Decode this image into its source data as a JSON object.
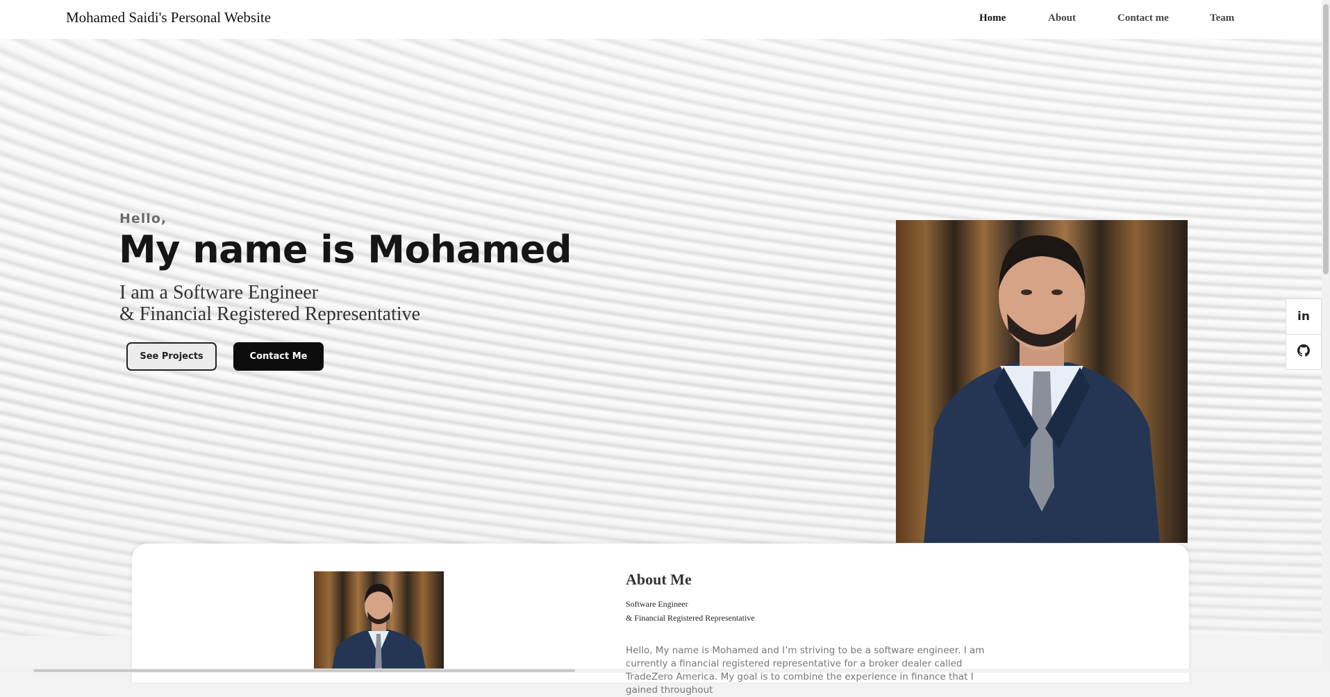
{
  "header": {
    "site_title": "Mohamed Saidi's Personal Website",
    "nav": [
      "Home",
      "About",
      "Contact me",
      "Team"
    ],
    "active_nav": "Home"
  },
  "hero": {
    "greeting": "Hello,",
    "name_line": "My name is Mohamed",
    "role_line_1": "I am a Software Engineer",
    "role_line_2": "& Financial Registered Representative",
    "btn_projects": "See Projects",
    "btn_contact": "Contact Me"
  },
  "social": {
    "linkedin_icon": "linkedin-icon",
    "linkedin_glyph": "in",
    "github_icon": "github-icon"
  },
  "about": {
    "title": "About Me",
    "subtitle_1": "Software Engineer",
    "subtitle_2": "& Financial Registered Representative",
    "paragraph": "Hello, My name is Mohamed and I’m striving to be a software engineer. I am currently a financial registered representative for a broker dealer called TradeZero America. My goal is to combine the experience in finance that I gained throughout"
  },
  "colors": {
    "primary_button": "#0d0d0d",
    "secondary_button": "#ececec",
    "text_dark": "#151515"
  }
}
